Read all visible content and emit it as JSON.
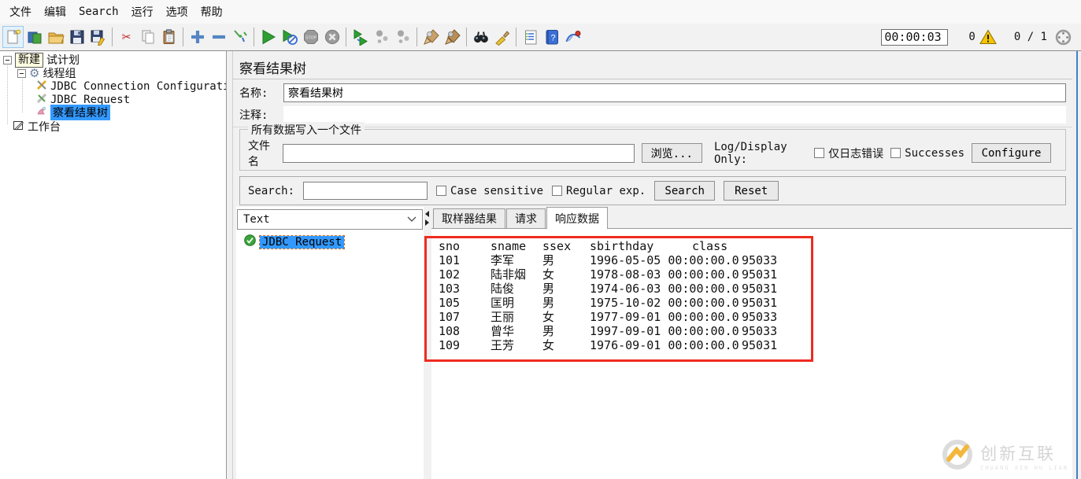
{
  "menu_bar": {
    "items": [
      "文件",
      "编辑",
      "Search",
      "运行",
      "选项",
      "帮助"
    ]
  },
  "toolbar": {
    "icons": [
      "new",
      "templates",
      "open",
      "save",
      "save-as",
      "|",
      "cut",
      "copy",
      "paste",
      "|",
      "add",
      "remove",
      "dropper",
      "|",
      "start",
      "start-no-timers",
      "stop",
      "shutdown",
      "|",
      "remote-start-all",
      "remote-stop-all",
      "remote-shutdown-all",
      "|",
      "clear",
      "clear-all",
      "|",
      "search",
      "search-reset",
      "|",
      "function-helper",
      "help",
      "links"
    ],
    "timer": "00:00:03",
    "error_count": "0",
    "threads": "0 / 1"
  },
  "tree": {
    "rename_tooltip": "新建",
    "test_plan_suffix": "试计划",
    "thread_group": "线程组",
    "jdbc_connection_configuration": "JDBC Connection Configurati",
    "jdbc_request": "JDBC Request",
    "view_results_tree": "察看结果树",
    "workbench": "工作台"
  },
  "panel": {
    "title": "察看结果树",
    "name_label": "名称:",
    "name_value": "察看结果树",
    "comment_label": "注释:",
    "comment_value": "",
    "file_group": {
      "legend": "所有数据写入一个文件",
      "filename_label": "文件名",
      "filename_value": "",
      "browse_button": "浏览...",
      "log_display_label": "Log/Display Only:",
      "errors_checkbox": "仅日志错误",
      "successes_checkbox": "Successes",
      "configure_button": "Configure"
    },
    "search_bar": {
      "label": "Search:",
      "value": "",
      "case_checkbox": "Case sensitive",
      "regex_checkbox": "Regular exp.",
      "search_button": "Search",
      "reset_button": "Reset"
    },
    "results": {
      "view_selector": "Text",
      "result_node": "JDBC Request",
      "tabs": [
        "取样器结果",
        "请求",
        "响应数据"
      ],
      "active_tab": "响应数据"
    }
  },
  "response_table": {
    "headers": [
      "sno",
      "sname",
      "ssex",
      "sbirthday",
      "class"
    ],
    "rows": [
      [
        "101",
        "李军",
        "男",
        "1996-05-05 00:00:00.0",
        "95033"
      ],
      [
        "102",
        "陆非烟",
        "女",
        "1978-08-03 00:00:00.0",
        "95031"
      ],
      [
        "103",
        "陆俊",
        "男",
        "1974-06-03 00:00:00.0",
        "95031"
      ],
      [
        "105",
        "匡明",
        "男",
        "1975-10-02 00:00:00.0",
        "95031"
      ],
      [
        "107",
        "王丽",
        "女",
        "1977-09-01 00:00:00.0",
        "95033"
      ],
      [
        "108",
        "曾华",
        "男",
        "1997-09-01 00:00:00.0",
        "95033"
      ],
      [
        "109",
        "王芳",
        "女",
        "1976-09-01 00:00:00.0",
        "95031"
      ]
    ]
  },
  "watermark": {
    "brand": "创新互联",
    "brand_sub": "CHUANG XIN HU LIAN"
  },
  "colors": {
    "selection_blue": "#3399ff",
    "annotation_box": "#ee2b1f",
    "run_green": "#2f9e33",
    "warning_yellow": "#f5c400",
    "window_bg": "#f0f0f0"
  }
}
